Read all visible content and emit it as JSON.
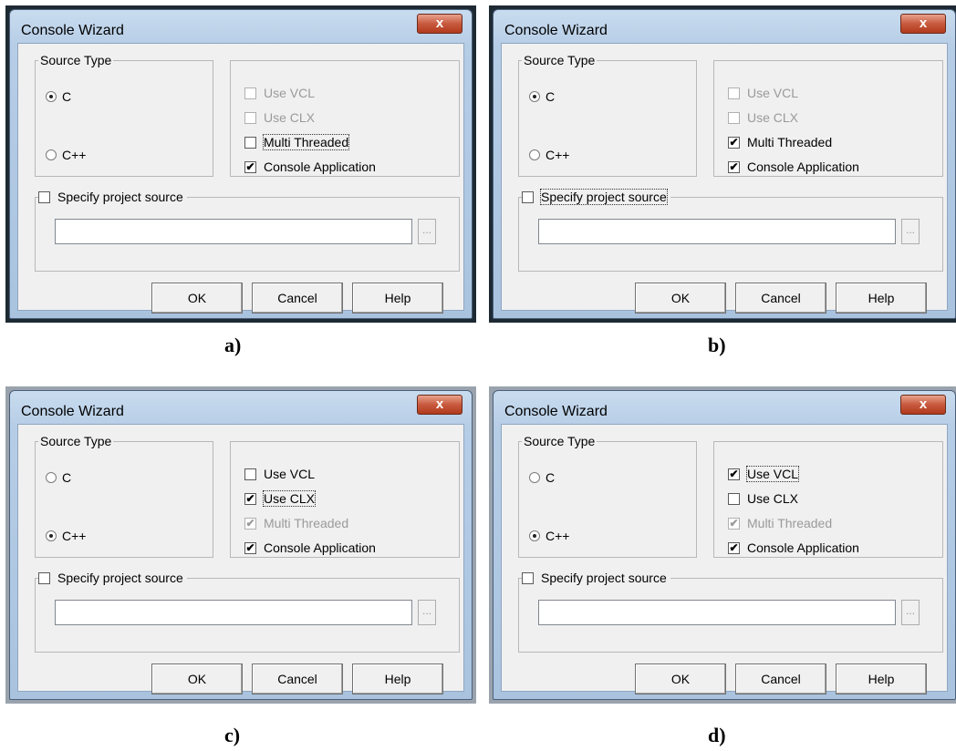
{
  "title": "Console Wizard",
  "close_glyph": "x",
  "source_type_label": "Source Type",
  "c_label": "C",
  "cpp_label": "C++",
  "use_vcl": "Use VCL",
  "use_clx": "Use CLX",
  "multi_threaded": "Multi Threaded",
  "console_application": "Console Application",
  "specify_source": "Specify project source",
  "browse_glyph": "...",
  "ok": "OK",
  "cancel": "Cancel",
  "help": "Help",
  "check_glyph": "✔",
  "captions": [
    "a)",
    "b)",
    "c)",
    "d)"
  ],
  "panels": [
    {
      "source": "C",
      "use_vcl": {
        "checked": false,
        "enabled": false
      },
      "use_clx": {
        "checked": false,
        "enabled": false
      },
      "multi_threaded": {
        "checked": false,
        "enabled": true
      },
      "console_application": {
        "checked": true,
        "enabled": true
      },
      "specify_source": false
    },
    {
      "source": "C",
      "use_vcl": {
        "checked": false,
        "enabled": false
      },
      "use_clx": {
        "checked": false,
        "enabled": false
      },
      "multi_threaded": {
        "checked": true,
        "enabled": true
      },
      "console_application": {
        "checked": true,
        "enabled": true
      },
      "specify_source": false
    },
    {
      "source": "C++",
      "use_vcl": {
        "checked": false,
        "enabled": true
      },
      "use_clx": {
        "checked": true,
        "enabled": true
      },
      "multi_threaded": {
        "checked": true,
        "enabled": false
      },
      "console_application": {
        "checked": true,
        "enabled": true
      },
      "specify_source": false
    },
    {
      "source": "C++",
      "use_vcl": {
        "checked": true,
        "enabled": true
      },
      "use_clx": {
        "checked": false,
        "enabled": true
      },
      "multi_threaded": {
        "checked": true,
        "enabled": false
      },
      "console_application": {
        "checked": true,
        "enabled": true
      },
      "specify_source": false
    }
  ]
}
